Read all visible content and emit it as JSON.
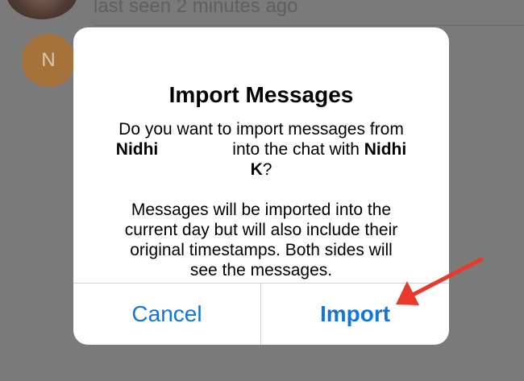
{
  "background": {
    "last_seen_text": "last seen 2 minutes ago",
    "contact_initial": "N"
  },
  "dialog": {
    "title": "Import Messages",
    "question_line1": "Do you want to import messages from",
    "question_name1": "Nidhi",
    "question_middle": "into the chat with",
    "question_name2_part1": "Nidhi",
    "question_name2_part2": "K",
    "question_end": "?",
    "info_line1": "Messages will be imported into the",
    "info_line2": "current day but will also include their",
    "info_line3": "original timestamps. Both sides will",
    "info_line4": "see the messages.",
    "cancel_label": "Cancel",
    "import_label": "Import"
  },
  "colors": {
    "accent": "#1574d8",
    "annotation_arrow": "#e8392a",
    "overlay": "#7a7a7b"
  }
}
